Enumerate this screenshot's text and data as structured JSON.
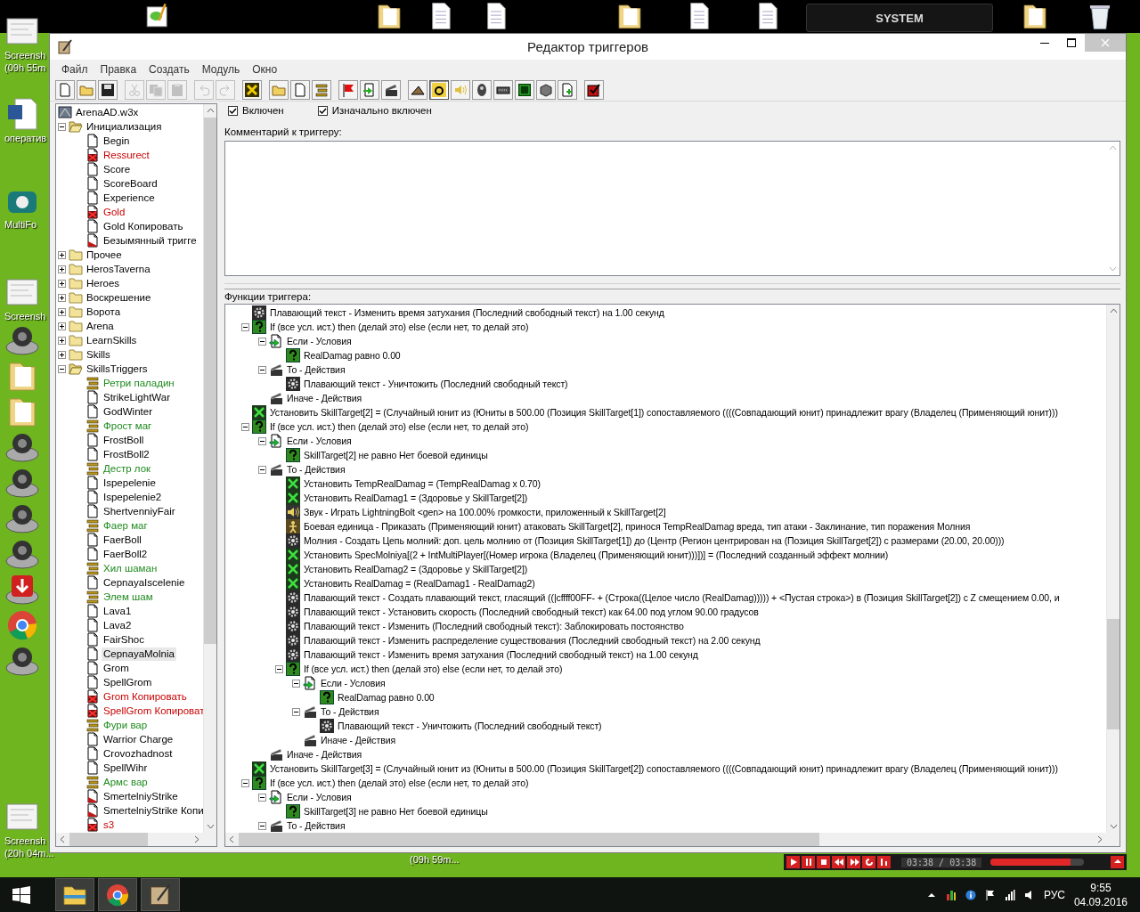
{
  "desktop": {
    "top_icons": [
      {
        "kind": "notepad"
      },
      {
        "kind": "folder"
      },
      {
        "kind": "document"
      },
      {
        "kind": "document"
      },
      {
        "kind": "folder"
      },
      {
        "kind": "document"
      },
      {
        "kind": "document"
      },
      {
        "kind": "folder"
      },
      {
        "kind": "bin"
      }
    ],
    "system_label": "SYSTEM",
    "left_icons": [
      {
        "kind": "thumbnail",
        "label_lines": [
          "Screensh",
          "(09h 55m"
        ]
      },
      {
        "kind": "word",
        "label_lines": [
          "оператив"
        ]
      },
      {
        "kind": "phone",
        "label_lines": [
          "MultiFo"
        ]
      },
      {
        "kind": "thumbnail",
        "label_lines": [
          "Screensh"
        ]
      },
      {
        "kind": "disc"
      },
      {
        "kind": "folder"
      },
      {
        "kind": "folder"
      },
      {
        "kind": "disc"
      },
      {
        "kind": "disc"
      },
      {
        "kind": "disc"
      },
      {
        "kind": "disc"
      },
      {
        "kind": "download"
      },
      {
        "kind": "chrome"
      },
      {
        "kind": "disc"
      },
      {
        "kind": "thumbnail",
        "label_lines": [
          "Screensh",
          "(20h 04m..."
        ]
      }
    ],
    "bottom_label": "(09h 59m..."
  },
  "window": {
    "title": "Редактор триггеров",
    "menu": [
      "Файл",
      "Правка",
      "Создать",
      "Модуль",
      "Окно"
    ],
    "toolbar": [
      [
        {
          "disabled": false,
          "pressed": false
        },
        {
          "disabled": false,
          "pressed": false
        },
        {
          "disabled": false,
          "pressed": false
        }
      ],
      [
        {
          "disabled": true,
          "pressed": false
        },
        {
          "disabled": true,
          "pressed": false
        },
        {
          "disabled": true,
          "pressed": false
        }
      ],
      [
        {
          "disabled": true,
          "pressed": false
        },
        {
          "disabled": true,
          "pressed": false
        }
      ],
      [
        {
          "disabled": false,
          "pressed": false
        }
      ],
      [
        {
          "disabled": false,
          "pressed": false
        },
        {
          "disabled": false,
          "pressed": false
        },
        {
          "disabled": false,
          "pressed": false
        }
      ],
      [
        {
          "disabled": false,
          "pressed": false
        },
        {
          "disabled": false,
          "pressed": false
        },
        {
          "disabled": false,
          "pressed": false
        }
      ],
      [
        {
          "disabled": false,
          "pressed": false
        },
        {
          "disabled": false,
          "pressed": true
        },
        {
          "disabled": false,
          "pressed": false
        },
        {
          "disabled": false,
          "pressed": false
        },
        {
          "disabled": false,
          "pressed": false
        },
        {
          "disabled": false,
          "pressed": false
        },
        {
          "disabled": false,
          "pressed": false
        },
        {
          "disabled": false,
          "pressed": false
        }
      ],
      [
        {
          "disabled": false,
          "pressed": false
        }
      ]
    ],
    "trigger_tree": {
      "label": "ArenaAD.w3x",
      "children": [
        {
          "kind": "folder",
          "label": "Инициализация",
          "expanded": true,
          "selected": false,
          "children": [
            {
              "kind": "trigger",
              "label": "Begin",
              "selected": false
            },
            {
              "kind": "disabled",
              "label": "Ressurect",
              "selected": false
            },
            {
              "kind": "trigger",
              "label": "Score",
              "selected": false
            },
            {
              "kind": "trigger",
              "label": "ScoreBoard",
              "selected": false
            },
            {
              "kind": "trigger",
              "label": "Experience",
              "selected": false
            },
            {
              "kind": "disabled",
              "label": "Gold",
              "selected": false
            },
            {
              "kind": "trigger",
              "label": "Gold Копировать",
              "selected": false
            },
            {
              "kind": "modified",
              "label": "Безымянный тригге",
              "selected": false
            }
          ]
        },
        {
          "kind": "folder",
          "label": "Прочее",
          "expanded": false,
          "selected": false
        },
        {
          "kind": "folder",
          "label": "HerosTaverna",
          "expanded": false,
          "selected": false
        },
        {
          "kind": "folder",
          "label": "Heroes",
          "expanded": false,
          "selected": false
        },
        {
          "kind": "folder",
          "label": "Воскрешение",
          "expanded": false,
          "selected": false
        },
        {
          "kind": "folder",
          "label": "Ворота",
          "expanded": false,
          "selected": false
        },
        {
          "kind": "folder",
          "label": "Arena",
          "expanded": false,
          "selected": false
        },
        {
          "kind": "folder",
          "label": "LearnSkills",
          "expanded": false,
          "selected": false
        },
        {
          "kind": "folder",
          "label": "Skills",
          "expanded": false,
          "selected": false
        },
        {
          "kind": "folder",
          "label": "SkillsTriggers",
          "expanded": true,
          "selected": false,
          "children": [
            {
              "kind": "comment",
              "label": "Ретри паладин",
              "selected": false
            },
            {
              "kind": "trigger",
              "label": "StrikeLightWar",
              "selected": false
            },
            {
              "kind": "trigger",
              "label": "GodWinter",
              "selected": false
            },
            {
              "kind": "comment",
              "label": "Фрост маг",
              "selected": false
            },
            {
              "kind": "trigger",
              "label": "FrostBoll",
              "selected": false
            },
            {
              "kind": "trigger",
              "label": "FrostBoll2",
              "selected": false
            },
            {
              "kind": "comment",
              "label": "Дестр лок",
              "selected": false
            },
            {
              "kind": "trigger",
              "label": "Ispepelenie",
              "selected": false
            },
            {
              "kind": "trigger",
              "label": "Ispepelenie2",
              "selected": false
            },
            {
              "kind": "trigger",
              "label": "ShertvenniyFair",
              "selected": false
            },
            {
              "kind": "comment",
              "label": "Фаер маг",
              "selected": false
            },
            {
              "kind": "trigger",
              "label": "FaerBoll",
              "selected": false
            },
            {
              "kind": "trigger",
              "label": "FaerBoll2",
              "selected": false
            },
            {
              "kind": "comment",
              "label": "Хил шаман",
              "selected": false
            },
            {
              "kind": "trigger",
              "label": "CepnayaIscelenie",
              "selected": false
            },
            {
              "kind": "comment",
              "label": "Элем шам",
              "selected": false
            },
            {
              "kind": "trigger",
              "label": "Lava1",
              "selected": false
            },
            {
              "kind": "trigger",
              "label": "Lava2",
              "selected": false
            },
            {
              "kind": "trigger",
              "label": "FairShoc",
              "selected": false
            },
            {
              "kind": "trigger",
              "label": "CepnayaMolnia",
              "selected": true
            },
            {
              "kind": "trigger",
              "label": "Grom",
              "selected": false
            },
            {
              "kind": "trigger",
              "label": "SpellGrom",
              "selected": false
            },
            {
              "kind": "disabled",
              "label": "Grom Копировать",
              "selected": false
            },
            {
              "kind": "disabled",
              "label": "SpellGrom Копироват",
              "selected": false
            },
            {
              "kind": "comment",
              "label": "Фури вар",
              "selected": false
            },
            {
              "kind": "trigger",
              "label": "Warrior Charge",
              "selected": false
            },
            {
              "kind": "trigger",
              "label": "Crovozhadnost",
              "selected": false
            },
            {
              "kind": "trigger",
              "label": "SpellWihr",
              "selected": false
            },
            {
              "kind": "comment",
              "label": "Армс вар",
              "selected": false
            },
            {
              "kind": "modified",
              "label": "SmertelniyStrike",
              "selected": false
            },
            {
              "kind": "modified",
              "label": "SmertelniyStrike Копи",
              "selected": false
            },
            {
              "kind": "disabled",
              "label": "s3",
              "selected": false
            }
          ]
        }
      ]
    },
    "checks": [
      {
        "label": "Включен",
        "checked": true
      },
      {
        "label": "Изначально включен",
        "checked": true
      }
    ],
    "comment_label": "Комментарий к триггеру:",
    "functions_label": "Функции триггера:",
    "functions": [
      {
        "kind": "float",
        "text": "Плавающий текст - Изменить время затухания (Последний свободный текст) на 1.00 секунд"
      },
      {
        "kind": "if",
        "text": "If (все усл. ист.) then (делай это) else (если нет, то делай это)",
        "expanded": true,
        "children": [
          {
            "kind": "conditions",
            "text": "Если - Условия",
            "expanded": true,
            "children": [
              {
                "kind": "condition",
                "text": "RealDamag равно 0.00"
              }
            ]
          },
          {
            "kind": "actions",
            "text": "То - Действия",
            "expanded": true,
            "children": [
              {
                "kind": "float",
                "text": "Плавающий текст - Уничтожить (Последний свободный текст)"
              }
            ]
          },
          {
            "kind": "actions",
            "text": "Иначе - Действия"
          }
        ]
      },
      {
        "kind": "set",
        "text": "Установить SkillTarget[2] = (Случайный юнит из (Юниты в 500.00 (Позиция SkillTarget[1]) сопоставляемого ((((Совпадающий юнит) принадлежит врагу (Владелец (Применяющий юнит)))"
      },
      {
        "kind": "if",
        "text": "If (все усл. ист.) then (делай это) else (если нет, то делай это)",
        "expanded": true,
        "children": [
          {
            "kind": "conditions",
            "text": "Если - Условия",
            "expanded": true,
            "children": [
              {
                "kind": "condition",
                "text": "SkillTarget[2] не равно Нет боевой единицы"
              }
            ]
          },
          {
            "kind": "actions",
            "text": "То - Действия",
            "expanded": true,
            "children": [
              {
                "kind": "set",
                "text": "Установить TempRealDamag = (TempRealDamag x 0.70)"
              },
              {
                "kind": "set",
                "text": "Установить RealDamag1 = (Здоровье у SkillTarget[2])"
              },
              {
                "kind": "sound",
                "text": "Звук - Играть LightningBolt <gen> на 100.00% громкости, приложенный к SkillTarget[2]"
              },
              {
                "kind": "unit",
                "text": "Боевая единица - Приказать (Применяющий юнит) атаковать SkillTarget[2], принося TempRealDamag вреда, тип атаки - Заклинание, тип поражения Молния"
              },
              {
                "kind": "lightning",
                "text": "Молния - Создать Цепь молний: доп. цель молнию от (Позиция SkillTarget[1]) до (Центр (Регион центрирован на (Позиция SkillTarget[2]) с размерами (20.00, 20.00)))"
              },
              {
                "kind": "set",
                "text": "Установить SpecMolniya[(2 + IntMultiPlayer[(Номер игрока (Владелец (Применяющий юнит)))])] = (Последний созданный эффект молнии)"
              },
              {
                "kind": "set",
                "text": "Установить RealDamag2 = (Здоровье у SkillTarget[2])"
              },
              {
                "kind": "set",
                "text": "Установить RealDamag = (RealDamag1 - RealDamag2)"
              },
              {
                "kind": "float",
                "text": "Плавающий текст - Создать плавающий текст, гласящий ((|cffff00FF- + (Строка((Целое число (RealDamag))))) + <Пустая строка>) в (Позиция SkillTarget[2]) с Z смещением 0.00, и"
              },
              {
                "kind": "float",
                "text": "Плавающий текст - Установить скорость (Последний свободный текст) как 64.00 под углом 90.00 градусов"
              },
              {
                "kind": "float",
                "text": "Плавающий текст - Изменить (Последний свободный текст): Заблокировать постоянство"
              },
              {
                "kind": "float",
                "text": "Плавающий текст - Изменить распределение существования (Последний свободный текст) на 2.00 секунд"
              },
              {
                "kind": "float",
                "text": "Плавающий текст - Изменить время затухания (Последний свободный текст) на 1.00 секунд"
              },
              {
                "kind": "if",
                "text": "If (все усл. ист.) then (делай это) else (если нет, то делай это)",
                "expanded": true,
                "children": [
                  {
                    "kind": "conditions",
                    "text": "Если - Условия",
                    "expanded": true,
                    "children": [
                      {
                        "kind": "condition",
                        "text": "RealDamag равно 0.00"
                      }
                    ]
                  },
                  {
                    "kind": "actions",
                    "text": "То - Действия",
                    "expanded": true,
                    "children": [
                      {
                        "kind": "float",
                        "text": "Плавающий текст - Уничтожить (Последний свободный текст)"
                      }
                    ]
                  },
                  {
                    "kind": "actions",
                    "text": "Иначе - Действия"
                  }
                ]
              }
            ]
          },
          {
            "kind": "actions",
            "text": "Иначе - Действия"
          }
        ]
      },
      {
        "kind": "set",
        "text": "Установить SkillTarget[3] = (Случайный юнит из (Юниты в 500.00 (Позиция SkillTarget[2]) сопоставляемого ((((Совпадающий юнит) принадлежит врагу (Владелец (Применяющий юнит)))"
      },
      {
        "kind": "if",
        "text": "If (все усл. ист.) then (делай это) else (если нет, то делай это)",
        "expanded": true,
        "children": [
          {
            "kind": "conditions",
            "text": "Если - Условия",
            "expanded": true,
            "children": [
              {
                "kind": "condition",
                "text": "SkillTarget[3] не равно Нет боевой единицы"
              }
            ]
          },
          {
            "kind": "actions",
            "text": "То - Действия",
            "expanded": true
          }
        ]
      }
    ]
  },
  "media_player": {
    "time": "03:38 / 03:38",
    "level": 0.85
  },
  "taskbar": {
    "apps": [
      {
        "kind": "explorer"
      },
      {
        "kind": "chrome"
      },
      {
        "kind": "quill"
      }
    ],
    "language": "РУС",
    "time": "9:55",
    "date": "04.09.2016"
  }
}
